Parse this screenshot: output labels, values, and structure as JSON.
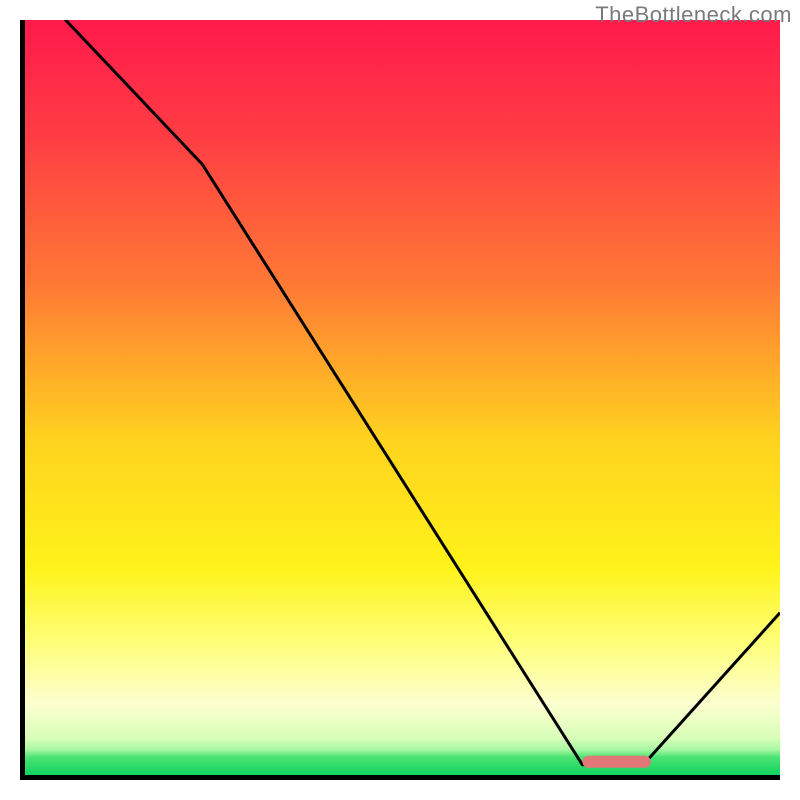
{
  "watermark": "TheBottleneck.com",
  "chart_data": {
    "type": "line",
    "title": "",
    "xlabel": "",
    "ylabel": "",
    "xlim": [
      0,
      100
    ],
    "ylim": [
      0,
      100
    ],
    "x": [
      0,
      6,
      24,
      74,
      82,
      100
    ],
    "values": [
      110,
      100,
      81,
      2,
      2,
      22
    ],
    "annotations": [
      {
        "kind": "marker",
        "shape": "rounded-bar",
        "x_start": 74,
        "x_end": 83,
        "y": 2.4,
        "color": "#e27777"
      }
    ],
    "background": {
      "type": "vertical-gradient",
      "stops": [
        {
          "pct": 0,
          "color": "#ff1a4b"
        },
        {
          "pct": 15,
          "color": "#ff3c44"
        },
        {
          "pct": 35,
          "color": "#ff7a35"
        },
        {
          "pct": 55,
          "color": "#ffd21f"
        },
        {
          "pct": 72,
          "color": "#fff31a"
        },
        {
          "pct": 82,
          "color": "#ffff7a"
        },
        {
          "pct": 90,
          "color": "#fdffd0"
        },
        {
          "pct": 94.5,
          "color": "#d8ffb8"
        },
        {
          "pct": 96,
          "color": "#a8f7a2"
        },
        {
          "pct": 97,
          "color": "#4be373"
        },
        {
          "pct": 100,
          "color": "#00cf5a"
        }
      ]
    }
  }
}
